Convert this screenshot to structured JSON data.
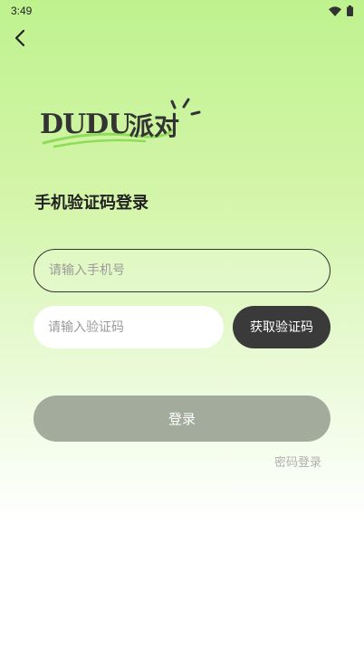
{
  "status_bar": {
    "time": "3:49",
    "icons": [
      "wifi-icon",
      "battery-icon"
    ]
  },
  "nav": {
    "back_icon": "chevron-left-icon"
  },
  "logo": {
    "text_en": "DUDU",
    "text_cn": "派对",
    "accent_color": "#8fdc5a"
  },
  "page": {
    "title": "手机验证码登录"
  },
  "form": {
    "phone_placeholder": "请输入手机号",
    "phone_value": "",
    "code_placeholder": "请输入验证码",
    "code_value": "",
    "get_code_label": "获取验证码",
    "login_label": "登录",
    "password_login_label": "密码登录"
  },
  "colors": {
    "get_code_bg": "#3a3a3a",
    "login_bg": "#a3ab9d",
    "link_color": "#b0b0b0"
  }
}
